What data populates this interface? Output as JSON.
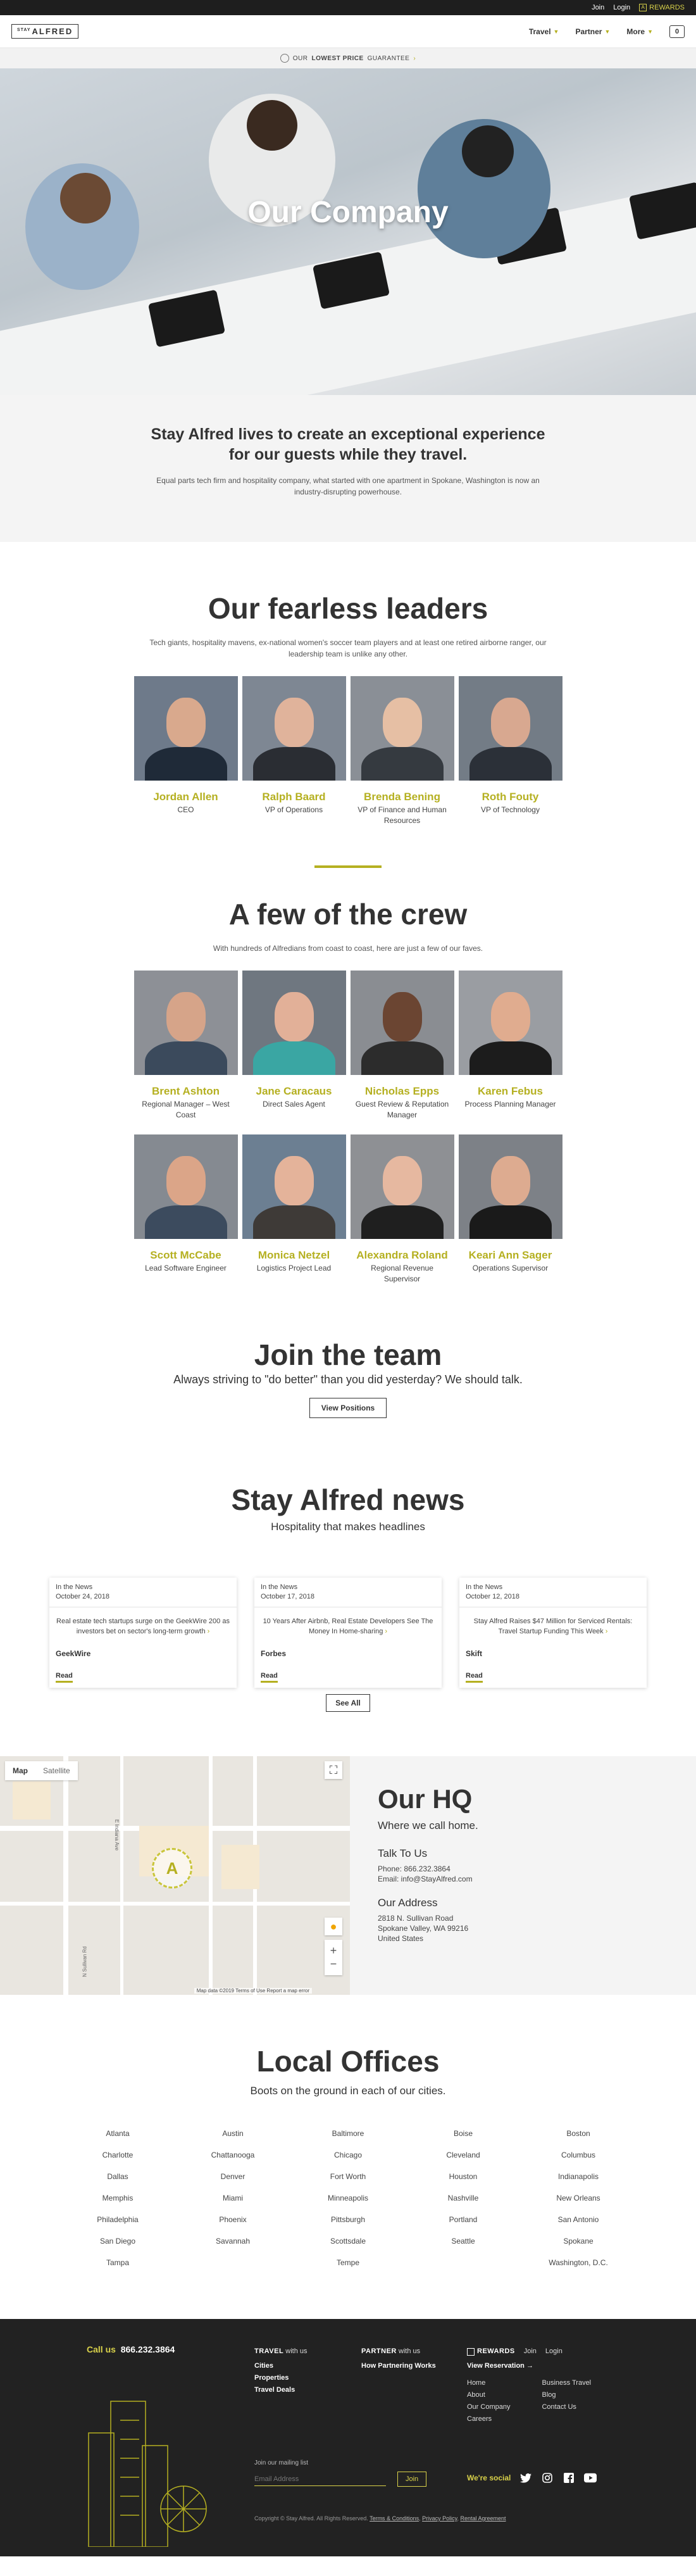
{
  "topbar": {
    "join": "Join",
    "login": "Login",
    "rewards": "REWARDS",
    "rewards_icon": "A"
  },
  "nav": {
    "logo_small": "STAY",
    "logo_main": "ALFRED",
    "items": [
      {
        "label": "Travel",
        "icon": "chevron-down-icon"
      },
      {
        "label": "Partner",
        "icon": "chevron-down-icon"
      },
      {
        "label": "More",
        "icon": "chevron-down-icon"
      }
    ],
    "cart_count": "0"
  },
  "guarantee": {
    "prefix": "OUR",
    "strong": "LOWEST PRICE",
    "suffix": "GUARANTEE",
    "arrow": "›"
  },
  "hero": {
    "title": "Our Company"
  },
  "mission": {
    "headline": "Stay Alfred lives to create an exceptional experience for our guests while they travel.",
    "text": "Equal parts tech firm and hospitality company, what started with one apartment in Spokane, Washington is now an industry-disrupting powerhouse."
  },
  "leaders": {
    "title": "Our fearless leaders",
    "lead": "Tech giants, hospitality mavens, ex-national women's soccer team players and at least one retired airborne ranger, our leadership team is unlike any other.",
    "people": [
      {
        "name": "Jordan Allen",
        "role": "CEO"
      },
      {
        "name": "Ralph Baard",
        "role": "VP of Operations"
      },
      {
        "name": "Brenda Bening",
        "role": "VP of Finance and Human Resources"
      },
      {
        "name": "Roth Fouty",
        "role": "VP of Technology"
      }
    ]
  },
  "crew": {
    "title": "A few of the crew",
    "lead": "With hundreds of Alfredians from coast to coast, here are just a few of our faves.",
    "people": [
      {
        "name": "Brent Ashton",
        "role": "Regional Manager – West Coast"
      },
      {
        "name": "Jane Caracaus",
        "role": "Direct Sales Agent"
      },
      {
        "name": "Nicholas Epps",
        "role": "Guest Review & Reputation Manager"
      },
      {
        "name": "Karen Febus",
        "role": "Process Planning Manager"
      },
      {
        "name": "Scott McCabe",
        "role": "Lead Software Engineer"
      },
      {
        "name": "Monica Netzel",
        "role": "Logistics Project Lead"
      },
      {
        "name": "Alexandra Roland",
        "role": "Regional Revenue Supervisor"
      },
      {
        "name": "Keari Ann Sager",
        "role": "Operations Supervisor"
      }
    ]
  },
  "join": {
    "title": "Join the team",
    "sub": "Always striving to \"do better\" than you did yesterday? We should talk.",
    "button": "View Positions"
  },
  "news": {
    "title": "Stay Alfred news",
    "sub": "Hospitality that makes headlines",
    "items": [
      {
        "label": "In the News",
        "date": "October 24, 2018",
        "title": "Real estate tech startups surge on the GeekWire 200 as investors bet on sector's long-term growth",
        "source": "GeekWire",
        "read": "Read"
      },
      {
        "label": "In the News",
        "date": "October 17, 2018",
        "title": "10 Years After Airbnb, Real Estate Developers See The Money In Home-sharing",
        "source": "Forbes",
        "read": "Read"
      },
      {
        "label": "In the News",
        "date": "October 12, 2018",
        "title": "Stay Alfred Raises $47 Million for Serviced Rentals: Travel Startup Funding This Week",
        "source": "Skift",
        "read": "Read"
      }
    ],
    "see_all": "See All"
  },
  "map": {
    "tab_map": "Map",
    "tab_satellite": "Satellite",
    "street1": "N Sullivan Rd",
    "street2": "E Indiana Ave",
    "pin_letter": "A",
    "attribution": "Map data ©2019   Terms of Use   Report a map error"
  },
  "hq": {
    "title": "Our HQ",
    "sub": "Where we call home.",
    "talk_title": "Talk To Us",
    "phone": "Phone: 866.232.3864",
    "email": "Email: info@StayAlfred.com",
    "address_title": "Our Address",
    "address1": "2818 N. Sullivan Road",
    "address2": "Spokane Valley, WA 99216",
    "address3": "United States"
  },
  "offices": {
    "title": "Local Offices",
    "sub": "Boots on the ground in each of our cities.",
    "cities": [
      "Atlanta",
      "Austin",
      "Baltimore",
      "Boise",
      "Boston",
      "Charlotte",
      "Chattanooga",
      "Chicago",
      "Cleveland",
      "Columbus",
      "Dallas",
      "Denver",
      "Fort Worth",
      "Houston",
      "Indianapolis",
      "Memphis",
      "Miami",
      "Minneapolis",
      "Nashville",
      "New Orleans",
      "Philadelphia",
      "Phoenix",
      "Pittsburgh",
      "Portland",
      "San Antonio",
      "San Diego",
      "Savannah",
      "Scottsdale",
      "Seattle",
      "Spokane",
      "Tampa",
      "",
      "Tempe",
      "",
      "Washington, D.C."
    ]
  },
  "footer": {
    "call_label": "Call us",
    "call_number": "866.232.3864",
    "travel_head_a": "TRAVEL",
    "travel_head_b": "with us",
    "travel_links": [
      "Cities",
      "Properties",
      "Travel Deals"
    ],
    "partner_head_a": "PARTNER",
    "partner_head_b": "with us",
    "partner_links": [
      "How Partnering Works"
    ],
    "rewards": "REWARDS",
    "join": "Join",
    "login": "Login",
    "view_reservation": "View Reservation →",
    "links_col1": [
      "Home",
      "About",
      "Our Company",
      "Careers"
    ],
    "links_col2": [
      "Business Travel",
      "Blog",
      "Contact Us"
    ],
    "mailing_label": "Join our mailing list",
    "email_placeholder": "Email Address",
    "join_button": "Join",
    "social_label": "We're social",
    "social_icons": [
      "twitter-icon",
      "instagram-icon",
      "facebook-icon",
      "youtube-icon"
    ],
    "copyright": "Copyright © Stay Alfred. All Rights Reserved.",
    "terms": "Terms & Conditions",
    "privacy": "Privacy Policy",
    "rental": "Rental Agreement"
  }
}
